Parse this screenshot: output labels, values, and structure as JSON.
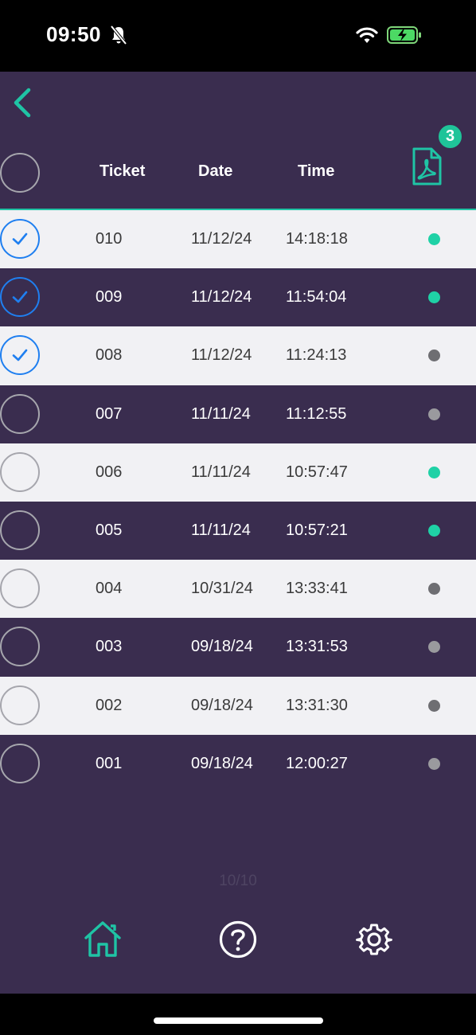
{
  "status_bar": {
    "time": "09:50"
  },
  "table": {
    "headers": {
      "ticket": "Ticket",
      "date": "Date",
      "time": "Time"
    },
    "pdf_badge_count": "3",
    "rows": [
      {
        "ticket": "010",
        "date": "11/12/24",
        "time": "14:18:18",
        "checked": true,
        "status": "active"
      },
      {
        "ticket": "009",
        "date": "11/12/24",
        "time": "11:54:04",
        "checked": true,
        "status": "active"
      },
      {
        "ticket": "008",
        "date": "11/12/24",
        "time": "11:24:13",
        "checked": true,
        "status": "inactive"
      },
      {
        "ticket": "007",
        "date": "11/11/24",
        "time": "11:12:55",
        "checked": false,
        "status": "inactive"
      },
      {
        "ticket": "006",
        "date": "11/11/24",
        "time": "10:57:47",
        "checked": false,
        "status": "active"
      },
      {
        "ticket": "005",
        "date": "11/11/24",
        "time": "10:57:21",
        "checked": false,
        "status": "active"
      },
      {
        "ticket": "004",
        "date": "10/31/24",
        "time": "13:33:41",
        "checked": false,
        "status": "inactive"
      },
      {
        "ticket": "003",
        "date": "09/18/24",
        "time": "13:31:53",
        "checked": false,
        "status": "inactive"
      },
      {
        "ticket": "002",
        "date": "09/18/24",
        "time": "13:31:30",
        "checked": false,
        "status": "inactive"
      },
      {
        "ticket": "001",
        "date": "09/18/24",
        "time": "12:00:27",
        "checked": false,
        "status": "inactive"
      }
    ]
  },
  "pagination": {
    "label": "10/10"
  },
  "nav": {
    "items": [
      {
        "icon": "home-icon",
        "active": true
      },
      {
        "icon": "help-icon",
        "active": false
      },
      {
        "icon": "gear-icon",
        "active": false
      }
    ]
  },
  "colors": {
    "accent": "#1fc4a5",
    "background": "#3a2d4f",
    "row_light": "#f1f1f4",
    "check_blue": "#1f7ff0",
    "dot_active": "#1fd1a6",
    "dot_inactive_light": "#6e6e72",
    "dot_inactive_dark": "#9a9a9e"
  }
}
